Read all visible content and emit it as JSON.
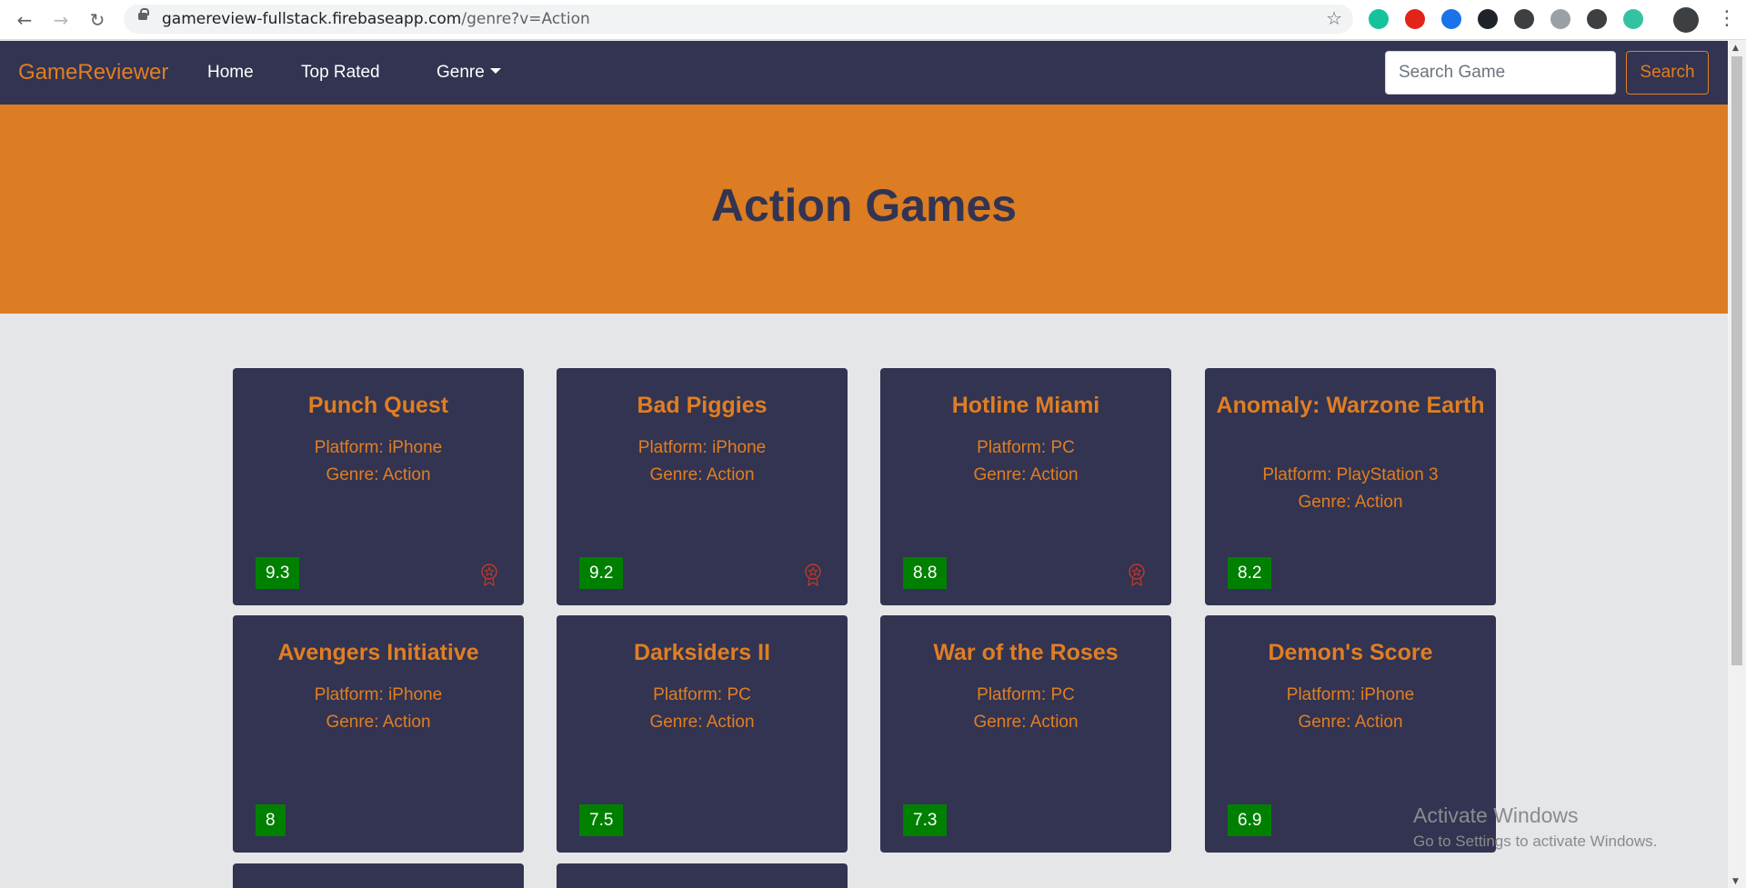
{
  "browser": {
    "url_host": "gamereview-fullstack.firebaseapp.com",
    "url_path": "/genre?v=Action",
    "back_icon": "arrow-left-icon",
    "forward_icon": "arrow-right-icon",
    "reload_icon": "reload-icon",
    "extensions": [
      {
        "name": "grammarly-icon",
        "color": "#15c39a"
      },
      {
        "name": "adblock-icon",
        "color": "#e2231a"
      },
      {
        "name": "screen-capture-icon",
        "color": "#1a73e8"
      },
      {
        "name": "react-devtools-icon",
        "color": "#20232a"
      },
      {
        "name": "dark-mode-icon",
        "color": "#3c4043"
      },
      {
        "name": "hypothesis-icon",
        "color": "#9aa0a6"
      },
      {
        "name": "terminal-icon",
        "color": "#3c4043"
      },
      {
        "name": "loader-icon",
        "color": "#34c3a0"
      }
    ]
  },
  "navbar": {
    "brand": "GameReviewer",
    "links": {
      "home": "Home",
      "top_rated": "Top Rated",
      "genre": "Genre"
    },
    "search_placeholder": "Search Game",
    "search_button": "Search"
  },
  "hero": {
    "title": "Action Games"
  },
  "games": [
    {
      "title": "Punch Quest",
      "platform": "Platform: iPhone",
      "genre": "Genre: Action",
      "rating": "9.3",
      "award": true
    },
    {
      "title": "Bad Piggies",
      "platform": "Platform: iPhone",
      "genre": "Genre: Action",
      "rating": "9.2",
      "award": true
    },
    {
      "title": "Hotline Miami",
      "platform": "Platform: PC",
      "genre": "Genre: Action",
      "rating": "8.8",
      "award": true
    },
    {
      "title": "Anomaly: Warzone Earth",
      "platform": "Platform: PlayStation 3",
      "genre": "Genre: Action",
      "rating": "8.2",
      "award": false
    },
    {
      "title": "Avengers Initiative",
      "platform": "Platform: iPhone",
      "genre": "Genre: Action",
      "rating": "8",
      "award": false
    },
    {
      "title": "Darksiders II",
      "platform": "Platform: PC",
      "genre": "Genre: Action",
      "rating": "7.5",
      "award": false
    },
    {
      "title": "War of the Roses",
      "platform": "Platform: PC",
      "genre": "Genre: Action",
      "rating": "7.3",
      "award": false
    },
    {
      "title": "Demon's Score",
      "platform": "Platform: iPhone",
      "genre": "Genre: Action",
      "rating": "6.9",
      "award": false
    }
  ],
  "watermark": {
    "title": "Activate Windows",
    "subtitle": "Go to Settings to activate Windows."
  },
  "colors": {
    "navbar": "#323451",
    "accent": "#e17e22",
    "hero": "#dc7c23",
    "rating": "#008000",
    "award": "#c0392b"
  }
}
